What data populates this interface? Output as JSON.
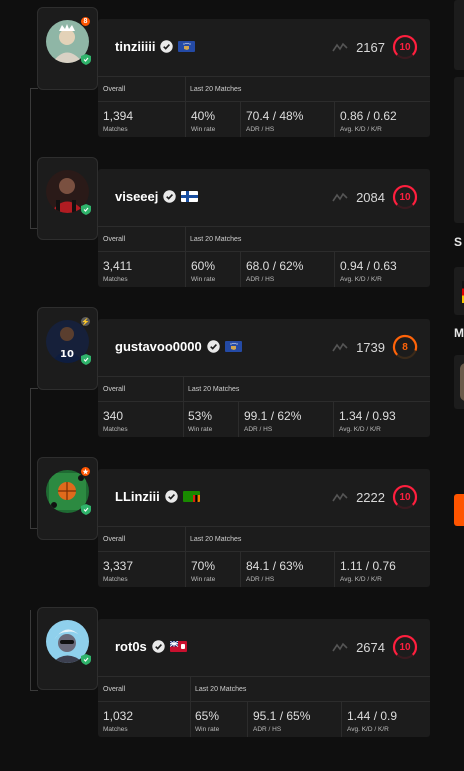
{
  "labels": {
    "overall": "Overall",
    "last20": "Last 20 Matches",
    "matches": "Matches",
    "winrate": "Win rate",
    "adr_hs": "ADR / HS",
    "kd_kr": "Avg. K/D / K/R"
  },
  "side": {
    "s_label": "S",
    "m_label": "M"
  },
  "colors": {
    "level10": "#fe1f3e",
    "level8": "#ff6309",
    "accent": "#ff5500"
  },
  "players": [
    {
      "name": "tinziiiii",
      "elo": "2167",
      "level": "10",
      "flag": "kosovo-flag",
      "matches": "1,394",
      "winrate": "40%",
      "adr_hs": "70.4 / 48%",
      "kd_kr": "0.86 / 0.62",
      "top_badge": "8"
    },
    {
      "name": "viseeej",
      "elo": "2084",
      "level": "10",
      "flag": "finland-flag",
      "matches": "3,411",
      "winrate": "60%",
      "adr_hs": "68.0 / 62%",
      "kd_kr": "0.94 / 0.63",
      "top_badge": ""
    },
    {
      "name": "gustavoo0000",
      "elo": "1739",
      "level": "8",
      "flag": "kosovo-flag",
      "matches": "340",
      "winrate": "53%",
      "adr_hs": "99.1 / 62%",
      "kd_kr": "1.34 / 0.93",
      "top_badge": "⚡"
    },
    {
      "name": "LLinziii",
      "elo": "2222",
      "level": "10",
      "flag": "zambia-flag",
      "matches": "3,337",
      "winrate": "70%",
      "adr_hs": "84.1 / 63%",
      "kd_kr": "1.11 / 0.76",
      "top_badge": "★"
    },
    {
      "name": "rot0s",
      "elo": "2674",
      "level": "10",
      "flag": "bermuda-flag",
      "matches": "1,032",
      "winrate": "65%",
      "adr_hs": "95.1 / 65%",
      "kd_kr": "1.44 / 0.9",
      "top_badge": ""
    }
  ]
}
